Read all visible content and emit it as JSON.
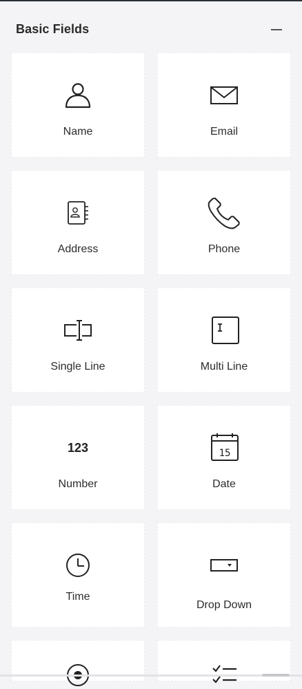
{
  "panel": {
    "title": "Basic Fields",
    "collapse_icon": "minus-icon"
  },
  "fields": [
    {
      "label": "Name",
      "icon": "user-icon"
    },
    {
      "label": "Email",
      "icon": "envelope-icon"
    },
    {
      "label": "Address",
      "icon": "address-book-icon"
    },
    {
      "label": "Phone",
      "icon": "phone-icon"
    },
    {
      "label": "Single Line",
      "icon": "single-line-input-icon"
    },
    {
      "label": "Multi Line",
      "icon": "multi-line-input-icon"
    },
    {
      "label": "Number",
      "icon": "number-icon",
      "glyph": "123"
    },
    {
      "label": "Date",
      "icon": "calendar-icon",
      "glyph": "15"
    },
    {
      "label": "Time",
      "icon": "clock-icon"
    },
    {
      "label": "Drop Down",
      "icon": "dropdown-icon"
    },
    {
      "label": "",
      "icon": "radio-icon"
    },
    {
      "label": "",
      "icon": "checklist-icon"
    }
  ]
}
